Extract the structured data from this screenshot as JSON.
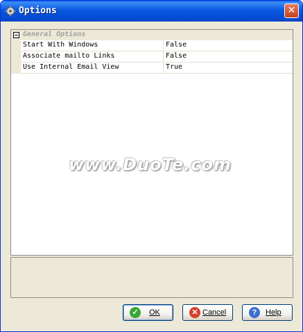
{
  "window": {
    "title": "Options",
    "close_label": "✕"
  },
  "grid": {
    "category": "General Options",
    "rows": [
      {
        "name": "Start With Windows",
        "value": "False"
      },
      {
        "name": "Associate mailto Links",
        "value": "False"
      },
      {
        "name": "Use Internal Email View",
        "value": "True"
      }
    ]
  },
  "watermark": "www.DuoTe.com",
  "buttons": {
    "ok": "OK",
    "cancel": "Cancel",
    "help": "Help"
  }
}
